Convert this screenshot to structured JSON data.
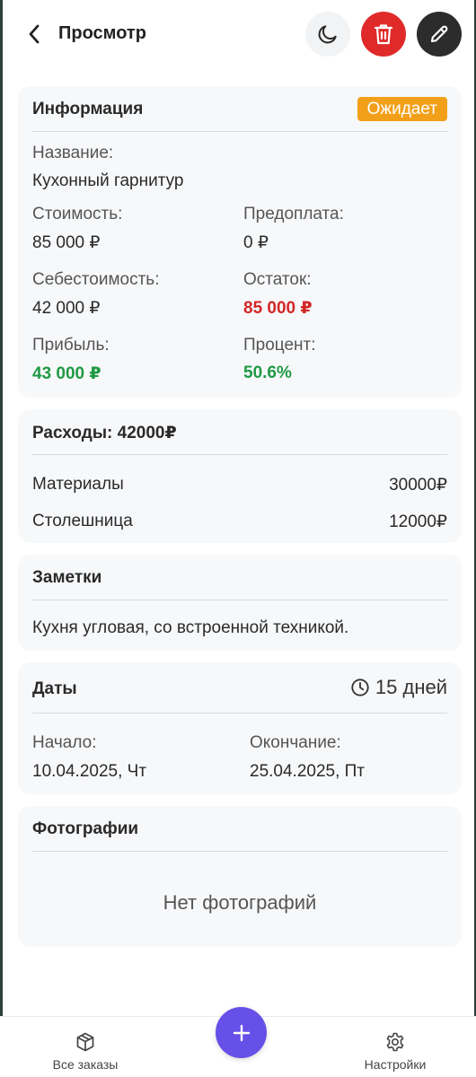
{
  "header": {
    "title": "Просмотр"
  },
  "info": {
    "title": "Информация",
    "status": "Ожидает",
    "name_label": "Название:",
    "name_value": "Кухонный гарнитур",
    "cost_label": "Стоимость:",
    "cost_value": "85 000 ₽",
    "prepay_label": "Предоплата:",
    "prepay_value": "0 ₽",
    "selfcost_label": "Себестоимость:",
    "selfcost_value": "42 000 ₽",
    "remaining_label": "Остаток:",
    "remaining_value": "85 000 ₽",
    "profit_label": "Прибыль:",
    "profit_value": "43 000 ₽",
    "percent_label": "Процент:",
    "percent_value": "50.6%"
  },
  "expenses": {
    "title": "Расходы: 42000₽",
    "items": [
      {
        "name": "Материалы",
        "amount": "30000₽"
      },
      {
        "name": "Столешница",
        "amount": "12000₽"
      }
    ]
  },
  "notes": {
    "title": "Заметки",
    "text": "Кухня угловая, со встроенной техникой."
  },
  "dates": {
    "title": "Даты",
    "duration": "15 дней",
    "start_label": "Начало:",
    "start_value": "10.04.2025, Чт",
    "end_label": "Окончание:",
    "end_value": "25.04.2025, Пт"
  },
  "photos": {
    "title": "Фотографии",
    "empty_text": "Нет фотографий"
  },
  "nav": {
    "orders_label": "Все заказы",
    "settings_label": "Настройки"
  },
  "colors": {
    "accent": "#6750e8",
    "danger": "#e02a2a",
    "status_pending": "#f2a01a",
    "positive": "#1f9a44",
    "negative": "#d32626"
  }
}
